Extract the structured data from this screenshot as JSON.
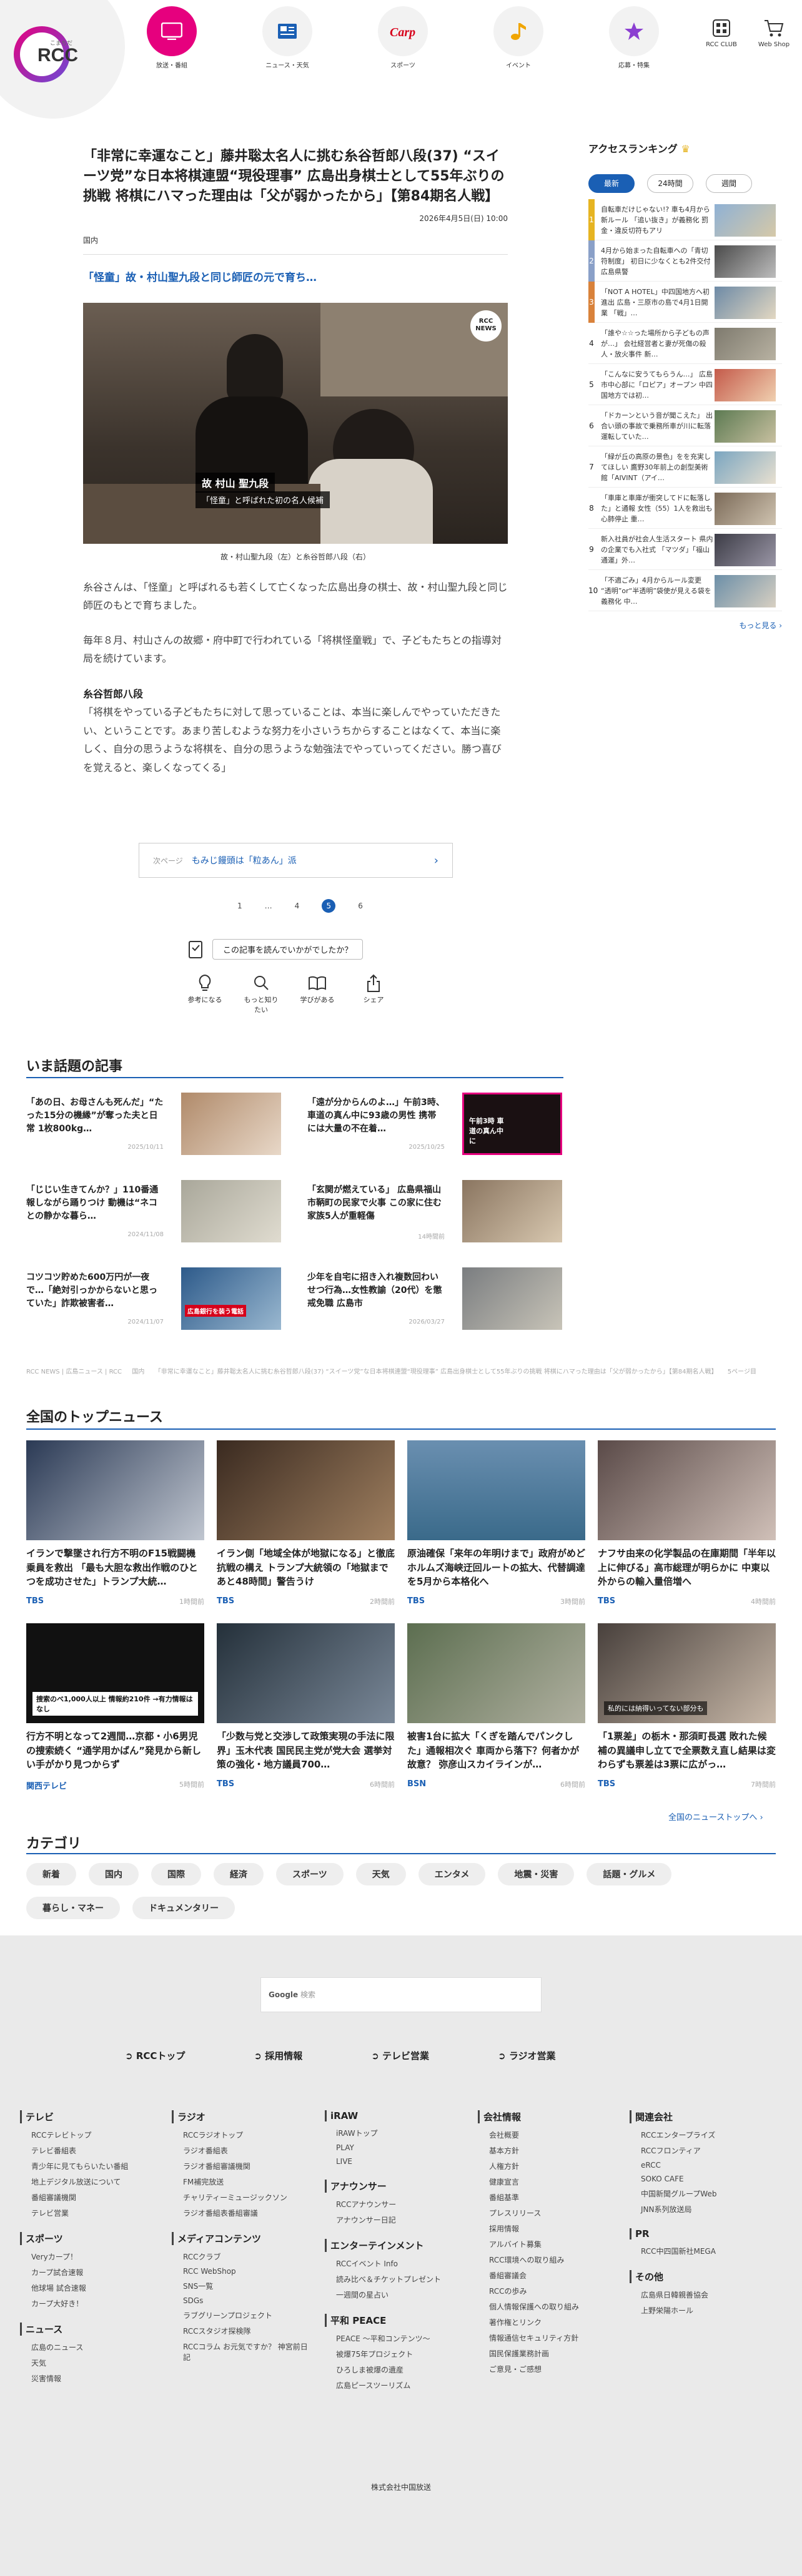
{
  "header": {
    "logo_text": "RCC",
    "logo_sub": "こまちだ",
    "nav": [
      {
        "label": "放送・番組",
        "icon": "tv-icon",
        "active": true
      },
      {
        "label": "ニュース・天気",
        "icon": "newspaper-icon"
      },
      {
        "label": "スポーツ",
        "icon": "carp-icon"
      },
      {
        "label": "イベント",
        "icon": "music-note-icon"
      },
      {
        "label": "応募・特集",
        "icon": "star-icon"
      }
    ],
    "club_label": "RCC CLUB",
    "shop_label": "Web Shop"
  },
  "article": {
    "headline": "「非常に幸運なこと」藤井聡太名人に挑む糸谷哲郎八段(37) “スイーツ党”な日本将棋連盟“現役理事” 広島出身棋士として55年ぶりの挑戦 将棋にハマった理由は「父が弱かったから」【第84期名人戦】",
    "date": "2026年4月5日(日) 10:00",
    "category": "国内",
    "subhead": "「怪童」故・村山聖九段と同じ師匠の元で育ち…",
    "photo_label_name": "故 村山 聖九段",
    "photo_label_sub": "「怪童」と呼ばれた初の名人候補",
    "photo_badge": "RCC NEWS",
    "caption": "故・村山聖九段（左）と糸谷哲郎八段（右）",
    "paragraphs": [
      "糸谷さんは、「怪童」と呼ばれるも若くして亡くなった広島出身の棋士、故・村山聖九段と同じ師匠のもとで育ちました。",
      "毎年８月、村山さんの故郷・府中町で行われている「将棋怪童戦」で、子どもたちとの指導対局を続けています。"
    ],
    "quote_head": "糸谷哲郎八段",
    "quote": "「将棋をやっている子どもたちに対して思っていることは、本当に楽しんでやっていただきたい、ということです。あまり苦しむような努力を小さいうちからすることはなくて、本当に楽しく、自分の思うような将棋を、自分の思うような勉強法でやっていってください。勝つ喜びを覚えると、楽しくなってくる」",
    "next_label": "次ページ",
    "next_title": "もみじ饅頭は「粒あん」派",
    "pager": [
      "1",
      "…",
      "4",
      "5",
      "6"
    ],
    "pager_current": "5",
    "question": "この記事を読んでいかがでしたか？",
    "reactions": [
      {
        "label": "参考になる",
        "icon": "lightbulb-icon"
      },
      {
        "label": "もっと知りたい",
        "icon": "magnifier-icon"
      },
      {
        "label": "学びがある",
        "icon": "book-icon"
      },
      {
        "label": "シェア",
        "icon": "share-icon"
      }
    ]
  },
  "ranking": {
    "title": "アクセスランキング",
    "tabs": [
      "最新",
      "24時間",
      "週間"
    ],
    "items": [
      {
        "n": "1",
        "text": "自転車だけじゃない!? 車も4月から新ルール 「追い抜き」が義務化 罰金・違反切符もアリ",
        "color": "#e6b422"
      },
      {
        "n": "2",
        "text": "4月から始まった自転車への「青切符制度」 初日に少なくとも2件交付 広島県警",
        "color": "#8aa0c8"
      },
      {
        "n": "3",
        "text": "「NOT A HOTEL」中四国地方へ初進出 広島・三原市の島で4月1日開業 「戦」…",
        "color": "#d9823b"
      },
      {
        "n": "4",
        "text": "「誰や☆☆った場所から子どもの声が…」 会社経営者と妻が死傷の殺人・放火事件 新…",
        "color": ""
      },
      {
        "n": "5",
        "text": "「こんなに安うてもらうん…」 広島市中心部に「ロピア」オープン 中四国地方では初…",
        "color": ""
      },
      {
        "n": "6",
        "text": "「ドカーンという音が聞こえた」 出合い頭の事故で乗務所車が川に転落 運転していた…",
        "color": ""
      },
      {
        "n": "7",
        "text": "「緑が丘の高原の景色」をを充実してほしい 鷹野30年前上の創型美術館「AIVINT（アイ…",
        "color": ""
      },
      {
        "n": "8",
        "text": "「車庫と車庫が衝突してドに転落した」と通報 女性（55）1人を救出も心肺停止 重…",
        "color": ""
      },
      {
        "n": "9",
        "text": "新入社員が社会人生活スタート 県内の企業でも入社式 「マツダ」「福山通運」外…",
        "color": ""
      },
      {
        "n": "10",
        "text": "「不適ごみ」4月からルール変更 “透明”or“半透明”袋使が見える袋を義務化 中…",
        "color": ""
      }
    ],
    "more": "もっと見る"
  },
  "hot": {
    "title": "いま話題の記事",
    "items": [
      {
        "text": "「あの日、お母さんも死んだ」“たった15分の機縁”が奪った夫と日常 1枚800kg…",
        "date": "2025/10/11"
      },
      {
        "text": "「遠が分からんのよ…」午前3時、車道の真ん中に93歳の男性 携帯には大量の不在着…",
        "date": "2025/10/25"
      },
      {
        "text": "「じじい生きてんか？」110番通報しながら踊りつけ 動機は“ネコとの静かな暮ら…",
        "date": "2024/11/08"
      },
      {
        "text": "「玄関が燃えている」 広島県福山市鞆町の民家で火事 この家に住む家族5人が重軽傷",
        "date": "14時間前"
      },
      {
        "text": "コツコツ貯めた600万円が一夜で…「絶対引っかからないと思っていた」詐欺被害者…",
        "date": "2024/11/07"
      },
      {
        "text": "少年を自宅に招き入れ複数回わいせつ行為…女性教諭（20代）を懲戒免職 広島市",
        "date": "2026/03/27"
      }
    ],
    "thumb_text_4": "午前3時 車道の真ん中に",
    "thumb_text_5": "広島銀行を装う電話"
  },
  "breadcrumb": "RCC NEWS | 広島ニュース | RCC 　 国内 　 「非常に幸運なこと」藤井聡太名人に挑む糸谷哲郎八段(37) “スイーツ党”な日本将棋連盟“現役理事” 広島出身棋士として55年ぶりの挑戦 将棋にハマった理由は「父が弱かったから」【第84期名人戦】 　 5ページ目",
  "top_news": {
    "title": "全国のトップニュース",
    "items": [
      {
        "text": "イランで撃墜され行方不明のF15戦闘機乗員を救出 「最も大胆な救出作戦のひとつを成功させた」トランプ大統…",
        "src": "TBS",
        "time": "1時間前"
      },
      {
        "text": "イラン側「地域全体が地獄になる」と徹底抗戦の構え トランプ大統領の「地獄まであと48時間」警告うけ",
        "src": "TBS",
        "time": "2時間前"
      },
      {
        "text": "原油確保「来年の年明けまで」政府がめど ホルムズ海峡迂回ルートの拡大、代替調達を5月から本格化へ",
        "src": "TBS",
        "time": "3時間前"
      },
      {
        "text": "ナフサ由来の化学製品の在庫期間「半年以上に伸びる」高市総理が明らかに 中東以外からの輸入量倍増へ",
        "src": "TBS",
        "time": "4時間前"
      },
      {
        "text": "行方不明となって2週間…京都・小6男児の捜索続く “通学用かばん”発見から新しい手がかり見つからず",
        "src": "関西テレビ",
        "time": "5時間前"
      },
      {
        "text": "「少数与党と交渉して政策実現の手法に限界」玉木代表 国民民主党が党大会 選挙対策の強化・地方議員700…",
        "src": "TBS",
        "time": "6時間前"
      },
      {
        "text": "被害1台に拡大「くぎを踏んでパンクした」通報相次ぐ 車両から落下？何者かが故意？ 弥彦山スカイラインが…",
        "src": "BSN",
        "time": "6時間前"
      },
      {
        "text": "「1票差」の栃木・那須町長選 敗れた候補の異議申し立てで全票数え直し結果は変わらずも票差は3票に広がっ…",
        "src": "TBS",
        "time": "7時間前"
      }
    ],
    "thumb_text_5": "捜索のべ1,000人以上 情報約210件 →有力情報はなし",
    "thumb_text_8": "私的には納得いってない部分も",
    "more": "全国のニューストップへ"
  },
  "categories": {
    "title": "カテゴリ",
    "chips": [
      "新着",
      "国内",
      "国際",
      "経済",
      "スポーツ",
      "天気",
      "エンタメ",
      "地震・災害",
      "話題・グルメ",
      "暮らし・マネー",
      "ドキュメンタリー"
    ]
  },
  "footer": {
    "search_brand": "Google",
    "search_placeholder": "検索",
    "links": [
      "RCCトップ",
      "採用情報",
      "テレビ営業",
      "ラジオ営業"
    ],
    "cols": [
      [
        {
          "head": "テレビ",
          "links": [
            "RCCテレビトップ",
            "テレビ番組表",
            "青少年に見てもらいたい番組",
            "地上デジタル放送について",
            "番組審議機関",
            "テレビ営業"
          ]
        },
        {
          "head": "スポーツ",
          "links": [
            "Veryカープ！",
            "カープ試合速報",
            "他球場 試合速報",
            "カープ大好き！"
          ]
        },
        {
          "head": "ニュース",
          "links": [
            "広島のニュース",
            "天気",
            "災害情報"
          ]
        }
      ],
      [
        {
          "head": "ラジオ",
          "links": [
            "RCCラジオトップ",
            "ラジオ番組表",
            "ラジオ番組審議機関",
            "FM補完放送",
            "チャリティーミュージックソン",
            "ラジオ番組表番組審議"
          ]
        },
        {
          "head": "メディアコンテンツ",
          "links": [
            "RCCクラブ",
            "RCC WebShop",
            "SNS一覧",
            "SDGs",
            "ラブグリーンプロジェクト",
            "RCCスタジオ探検隊",
            "RCCコラム お元気ですか？ 神宮前日記"
          ]
        }
      ],
      [
        {
          "head": "iRAW",
          "links": [
            "iRAWトップ",
            "PLAY",
            "LIVE"
          ]
        },
        {
          "head": "アナウンサー",
          "links": [
            "RCCアナウンサー",
            "アナウンサー日記"
          ]
        },
        {
          "head": "エンターテインメント",
          "links": [
            "RCCイベント Info",
            "読み比べ＆チケットプレゼント",
            "一週間の星占い"
          ]
        },
        {
          "head": "平和 PEACE",
          "links": [
            "PEACE ～平和コンテンツ～",
            "被爆75年プロジェクト",
            "ひろしま被爆の遺産",
            "広島ピースツーリズム"
          ]
        }
      ],
      [
        {
          "head": "会社情報",
          "links": [
            "会社概要",
            "基本方針",
            "人権方針",
            "健康宣言",
            "番組基準",
            "プレスリリース",
            "採用情報",
            "アルバイト募集",
            "RCC環境への取り組み",
            "番組審議会",
            "RCCの歩み",
            "個人情報保護への取り組み",
            "著作権とリンク",
            "情報通信セキュリティ方針",
            "国民保護業務計画",
            "ご意見・ご感想"
          ]
        }
      ],
      [
        {
          "head": "関連会社",
          "links": [
            "RCCエンタープライズ",
            "RCCフロンティア",
            "eRCC",
            "SOKO CAFE",
            "中国新聞グループWeb",
            "JNN系列放送局"
          ]
        },
        {
          "head": "PR",
          "links": [
            "RCC中四国新社MEGA"
          ]
        },
        {
          "head": "その他",
          "links": [
            "広島県日韓親善協会",
            "上野栄陽ホール"
          ]
        }
      ]
    ],
    "copyright": "株式会社中国放送"
  }
}
